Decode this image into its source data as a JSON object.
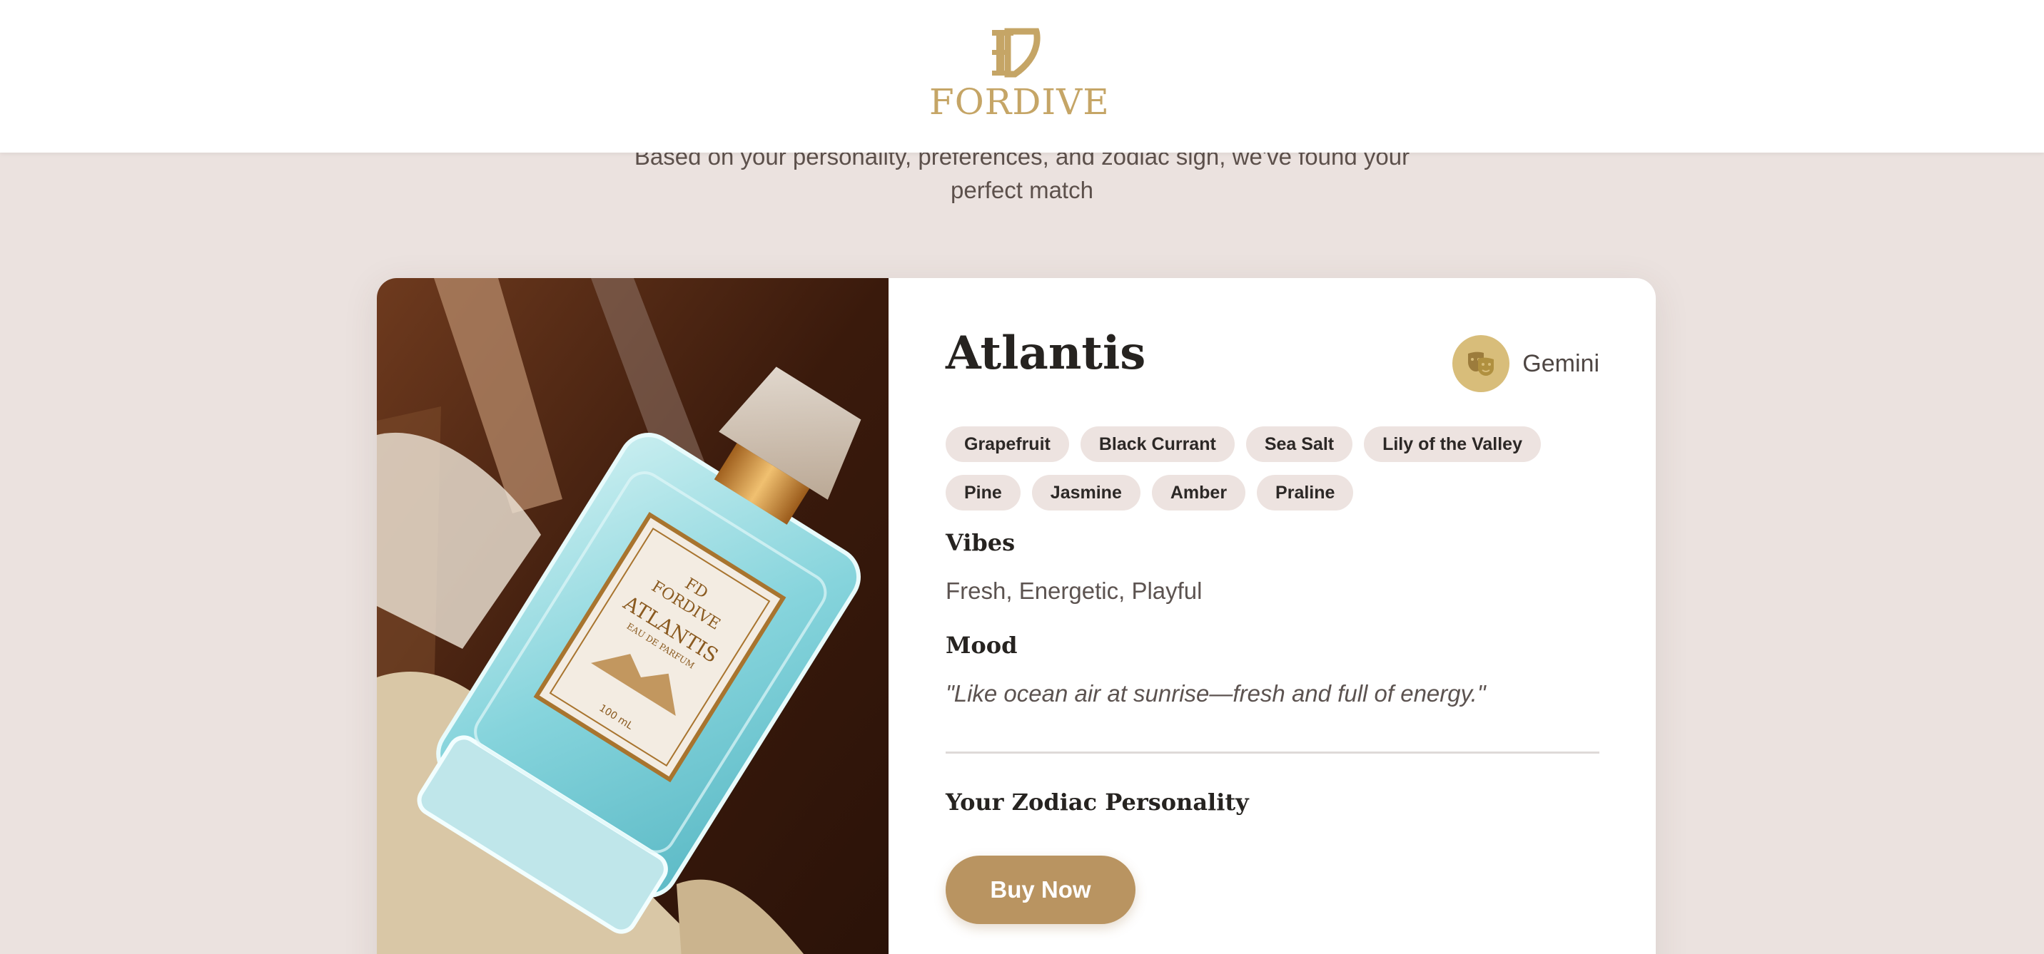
{
  "brand": {
    "logo_text": "FORDIVE",
    "logo_monogram": "FD",
    "accent_color": "#c5a566"
  },
  "intro": {
    "line1": "Based on your personality, preferences, and zodiac sign, we've found your",
    "line2": "perfect match"
  },
  "product": {
    "name": "Atlantis",
    "image_icon": "perfume-bottle-photo",
    "zodiac": {
      "sign": "Gemini",
      "icon": "theater-masks-icon",
      "icon_bg": "#d8bd7a"
    },
    "notes_row1": [
      "Grapefruit",
      "Black Currant",
      "Sea Salt",
      "Lily of the Valley"
    ],
    "notes_row2": [
      "Pine",
      "Jasmine",
      "Amber",
      "Praline"
    ],
    "vibes_heading": "Vibes",
    "vibes": "Fresh, Energetic, Playful",
    "mood_heading": "Mood",
    "mood": "\"Like ocean air at sunrise—fresh and full of energy.\"",
    "zodiac_personality_heading": "Your Zodiac Personality",
    "buy_label": "Buy Now",
    "button_color": "#b99461"
  }
}
